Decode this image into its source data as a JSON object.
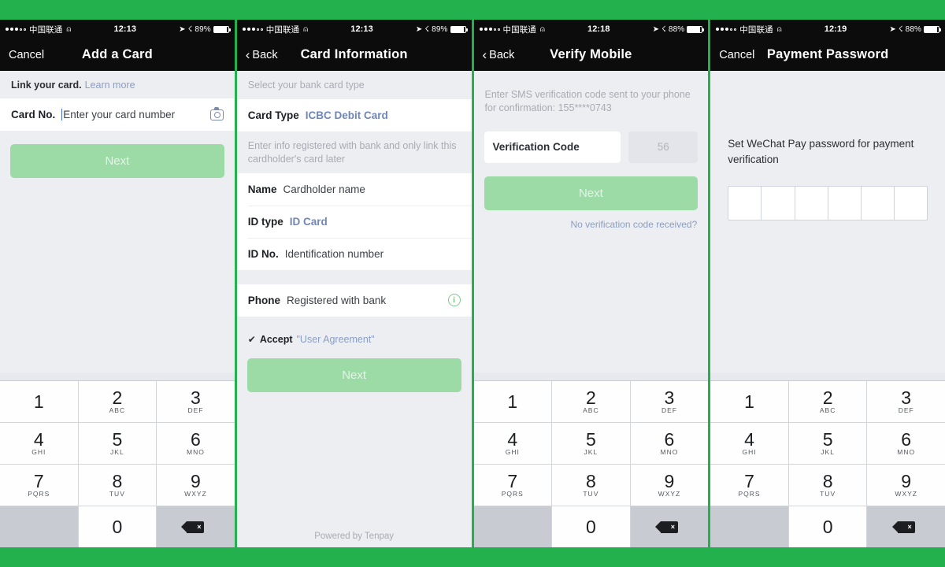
{
  "theme": {
    "frame_green": "#22b14c",
    "panel_bg": "#eceef2",
    "navbar_bg": "#0c0c0c",
    "next_button_green": "#9cdba6",
    "link_blue": "#8b9ec4",
    "accent_blue": "#6f86b8"
  },
  "panels": [
    {
      "id": "add-a-card",
      "status": {
        "carrier": "中国联通",
        "wifi_icon": "wifi-icon",
        "time": "12:13",
        "location_icon": "location-arrow-icon",
        "bluetooth_icon": "bluetooth-icon",
        "battery": "89%"
      },
      "nav": {
        "left_label": "Cancel",
        "title": "Add a Card",
        "back_icon": ""
      },
      "hint": {
        "bold": "Link your card.",
        "link": "Learn more"
      },
      "card_row": {
        "label": "Card No.",
        "placeholder": "Enter your card number",
        "camera_icon": "camera-icon"
      },
      "next_label": "Next"
    },
    {
      "id": "card-information",
      "status": {
        "carrier": "中国联通",
        "wifi_icon": "wifi-icon",
        "time": "12:13",
        "battery": "89%"
      },
      "nav": {
        "left_label": "Back",
        "title": "Card Information",
        "back_icon": "chevron-left-icon"
      },
      "hint_top": "Select your bank card type",
      "card_type": {
        "label": "Card Type",
        "value": "ICBC Debit Card"
      },
      "hint_mid": "Enter info registered with bank and only link this cardholder's card later",
      "fields": [
        {
          "label": "Name",
          "value": "Cardholder name",
          "style": "placeholder"
        },
        {
          "label": "ID type",
          "value": "ID Card",
          "style": "blue"
        },
        {
          "label": "ID No.",
          "value": "Identification number",
          "style": "placeholder"
        }
      ],
      "phone_row": {
        "label": "Phone",
        "value": "Registered with bank",
        "info_icon": "info-circle-icon"
      },
      "agreement": {
        "checkbox_icon": "checkbox-checked-icon",
        "accept": "Accept",
        "link": "\"User Agreement\""
      },
      "next_label": "Next",
      "footer": "Powered by Tenpay"
    },
    {
      "id": "verify-mobile",
      "status": {
        "carrier": "中国联通",
        "wifi_icon": "wifi-icon",
        "time": "12:18",
        "battery": "88%"
      },
      "nav": {
        "left_label": "Back",
        "title": "Verify Mobile",
        "back_icon": "chevron-left-icon"
      },
      "hint": "Enter SMS verification code sent to your phone for confirmation: 155****0743",
      "code_input": {
        "placeholder": "Verification Code"
      },
      "timer": "56",
      "next_label": "Next",
      "no_code_link": "No verification code received?"
    },
    {
      "id": "payment-password",
      "status": {
        "carrier": "中国联通",
        "wifi_icon": "wifi-icon",
        "time": "12:19",
        "battery": "88%"
      },
      "nav": {
        "left_label": "Cancel",
        "title": "Payment Password",
        "back_icon": ""
      },
      "prompt": "Set WeChat Pay password for payment verification",
      "password_boxes": 6
    }
  ],
  "keypad": {
    "keys": [
      {
        "num": "1",
        "sub": ""
      },
      {
        "num": "2",
        "sub": "ABC"
      },
      {
        "num": "3",
        "sub": "DEF"
      },
      {
        "num": "4",
        "sub": "GHI"
      },
      {
        "num": "5",
        "sub": "JKL"
      },
      {
        "num": "6",
        "sub": "MNO"
      },
      {
        "num": "7",
        "sub": "PQRS"
      },
      {
        "num": "8",
        "sub": "TUV"
      },
      {
        "num": "9",
        "sub": "WXYZ"
      },
      {
        "num": "",
        "sub": ""
      },
      {
        "num": "0",
        "sub": ""
      },
      {
        "num": "delete-icon",
        "sub": ""
      }
    ],
    "delete_glyph": "×"
  }
}
